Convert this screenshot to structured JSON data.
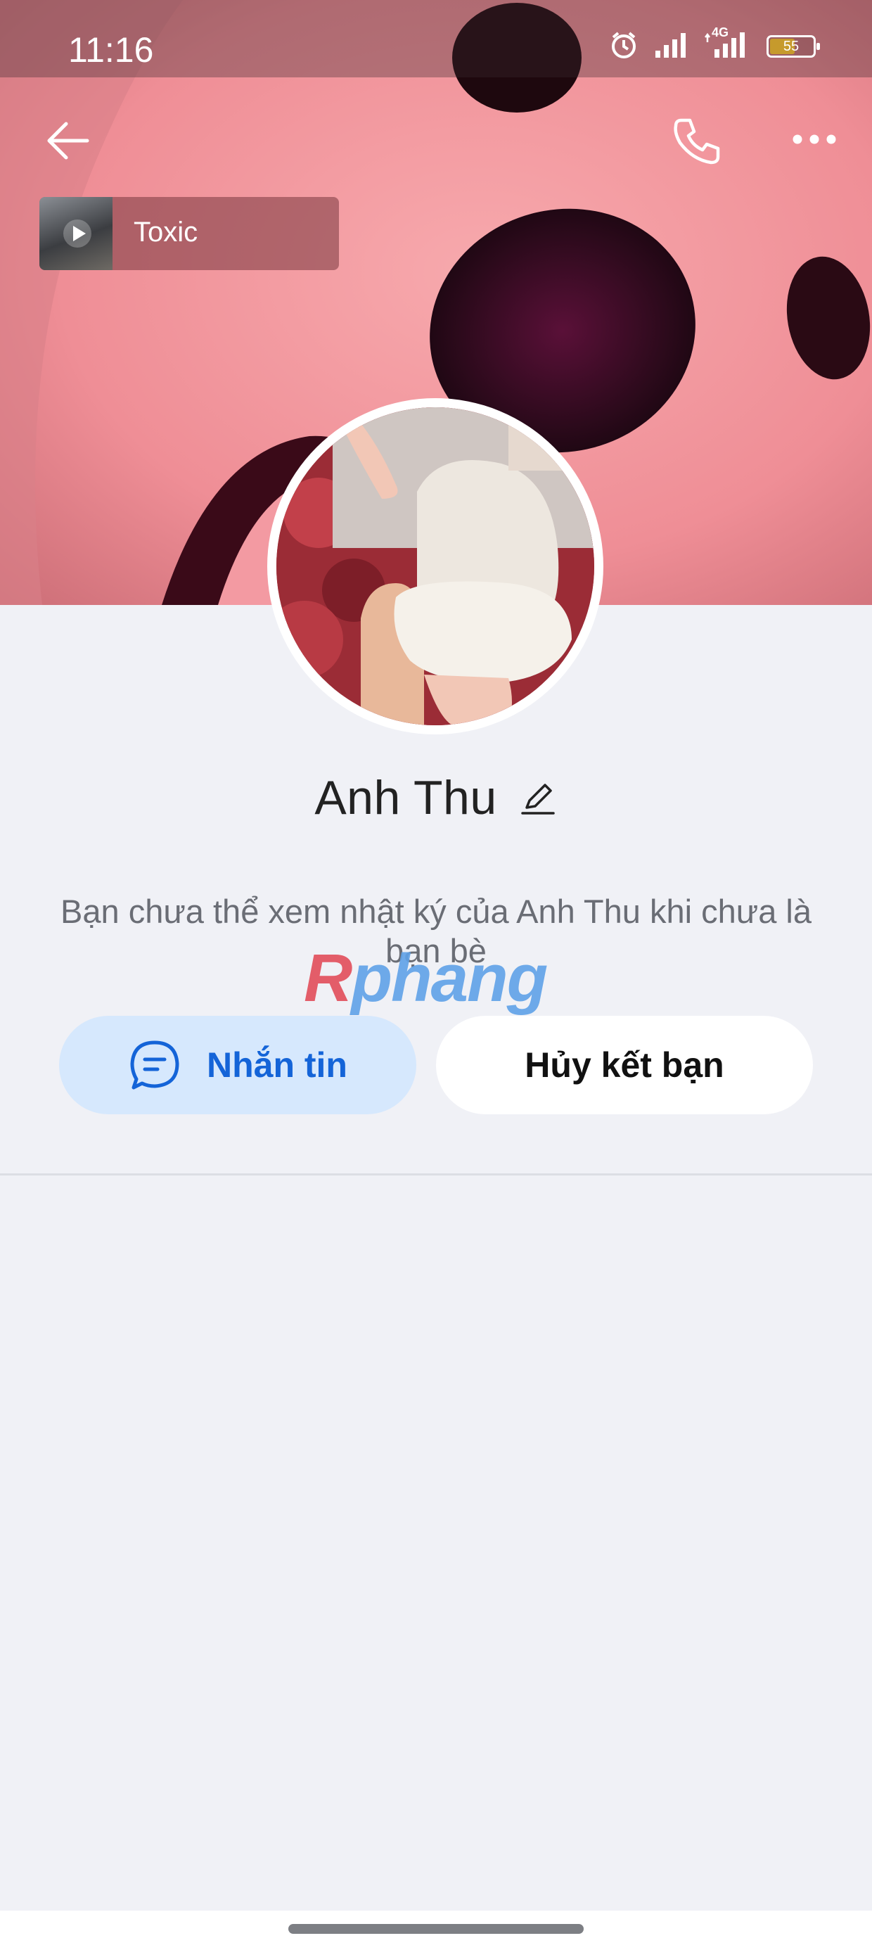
{
  "status_bar": {
    "time": "11:16",
    "network": "4G",
    "battery": "55",
    "icons": [
      "alarm-icon",
      "signal-icon",
      "signal-4g-icon",
      "battery-icon"
    ]
  },
  "header": {
    "back_icon": "arrow-left-icon",
    "call_icon": "phone-icon",
    "more_icon": "more-horizontal-icon"
  },
  "music": {
    "title": "Toxic",
    "icon": "play-icon"
  },
  "profile": {
    "name": "Anh Thu",
    "edit_icon": "pencil-icon",
    "notice": "Bạn chưa thể xem nhật ký của Anh Thu khi chưa là bạn bè"
  },
  "watermark": {
    "first_letter": "R",
    "rest": "phang"
  },
  "actions": {
    "message_label": "Nhắn tin",
    "message_icon": "chat-bubble-icon",
    "unfriend_label": "Hủy kết bạn"
  },
  "colors": {
    "accent": "#1464d8",
    "message_button_bg": "#d6e8fd",
    "page_bg": "#f0f1f6"
  }
}
